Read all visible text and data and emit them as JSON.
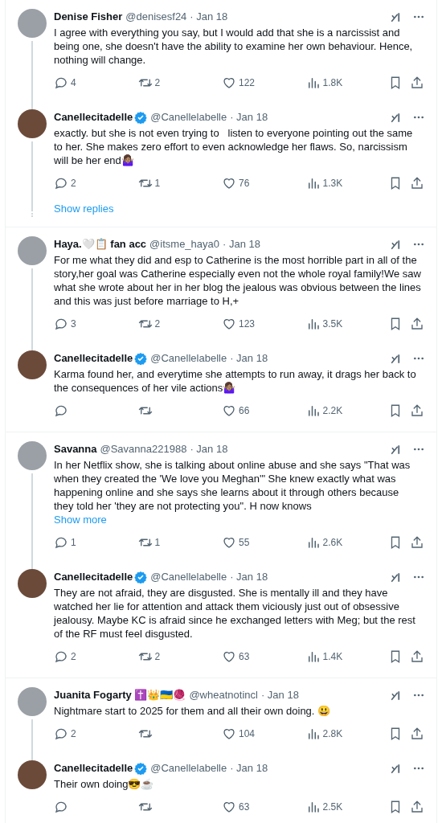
{
  "threads": [
    {
      "tweets": [
        {
          "name": "Denise Fisher",
          "verified": false,
          "handle": "@denisesf24",
          "date": "· Jan 18",
          "text": "I agree with everything you say, but I would add that she is a narcissist and being one, she doesn't have the ability to examine her own behaviour. Hence, nothing will change.",
          "stats": {
            "replies": "4",
            "reposts": "2",
            "likes": "122",
            "views": "1.8K"
          }
        },
        {
          "name": "Canellecitadelle",
          "verified": true,
          "handle": "@Canellelabelle",
          "date": "· Jan 18",
          "text": "exactly. but she is not even trying to   listen to everyone pointing out the same to her. She makes zero effort to even acknowledge her flaws. So, narcissism will be her end🤷🏽‍♀️",
          "stats": {
            "replies": "2",
            "reposts": "1",
            "likes": "76",
            "views": "1.3K"
          }
        }
      ],
      "show_replies": "Show replies"
    },
    {
      "tweets": [
        {
          "name": "Haya.🤍📋 fan acc",
          "verified": false,
          "handle": "@itsme_haya0",
          "date": "· Jan 18",
          "text": "For me what they did and esp to Catherine is the most horrible part in all of the story,her goal was Catherine especially even not the whole royal family!We saw what she wrote about her in her blog the jealous was obvious between the lines and this was just before marriage to H,+",
          "stats": {
            "replies": "3",
            "reposts": "2",
            "likes": "123",
            "views": "3.5K"
          }
        },
        {
          "name": "Canellecitadelle",
          "verified": true,
          "handle": "@Canellelabelle",
          "date": "· Jan 18",
          "text": "Karma found her, and everytime she attempts to run away, it drags her back to the consequences of her vile actions🤷🏽‍♀️",
          "stats": {
            "likes": "66",
            "views": "2.2K"
          }
        }
      ]
    },
    {
      "tweets": [
        {
          "name": "Savanna",
          "verified": false,
          "handle": "@Savanna221988",
          "date": "· Jan 18",
          "text": "In her Netflix show, she is talking about online abuse and she says \"That was when they created the 'We love you Meghan'\" She knew exactly what was happening online and she says she learns about it through others because they told her 'they are not protecting you\". H now knows",
          "show_more": "Show more",
          "stats": {
            "replies": "1",
            "reposts": "1",
            "likes": "55",
            "views": "2.6K"
          }
        },
        {
          "name": "Canellecitadelle",
          "verified": true,
          "handle": "@Canellelabelle",
          "date": "· Jan 18",
          "text": "They are not afraid, they are disgusted. She is mentally ill and they have watched her lie for attention and attack them viciously just out of obsessive jealousy. Maybe KC is afraid since he exchanged letters with Meg; but the rest of the RF must feel disgusted.",
          "stats": {
            "replies": "2",
            "reposts": "2",
            "likes": "63",
            "views": "1.4K"
          }
        }
      ]
    },
    {
      "tweets": [
        {
          "name": "Juanita Fogarty ✝️👑🇺🇦🧶",
          "verified": false,
          "handle": "@wheatnotincl",
          "date": "· Jan 18",
          "text": "Nightmare start to 2025 for them and all their own doing. 😃",
          "stats": {
            "replies": "2",
            "likes": "104",
            "views": "2.8K"
          }
        },
        {
          "name": "Canellecitadelle",
          "verified": true,
          "handle": "@Canellelabelle",
          "date": "· Jan 18",
          "text": "Their own doing😎☕",
          "stats": {
            "likes": "63",
            "views": "2.5K"
          }
        }
      ]
    }
  ]
}
